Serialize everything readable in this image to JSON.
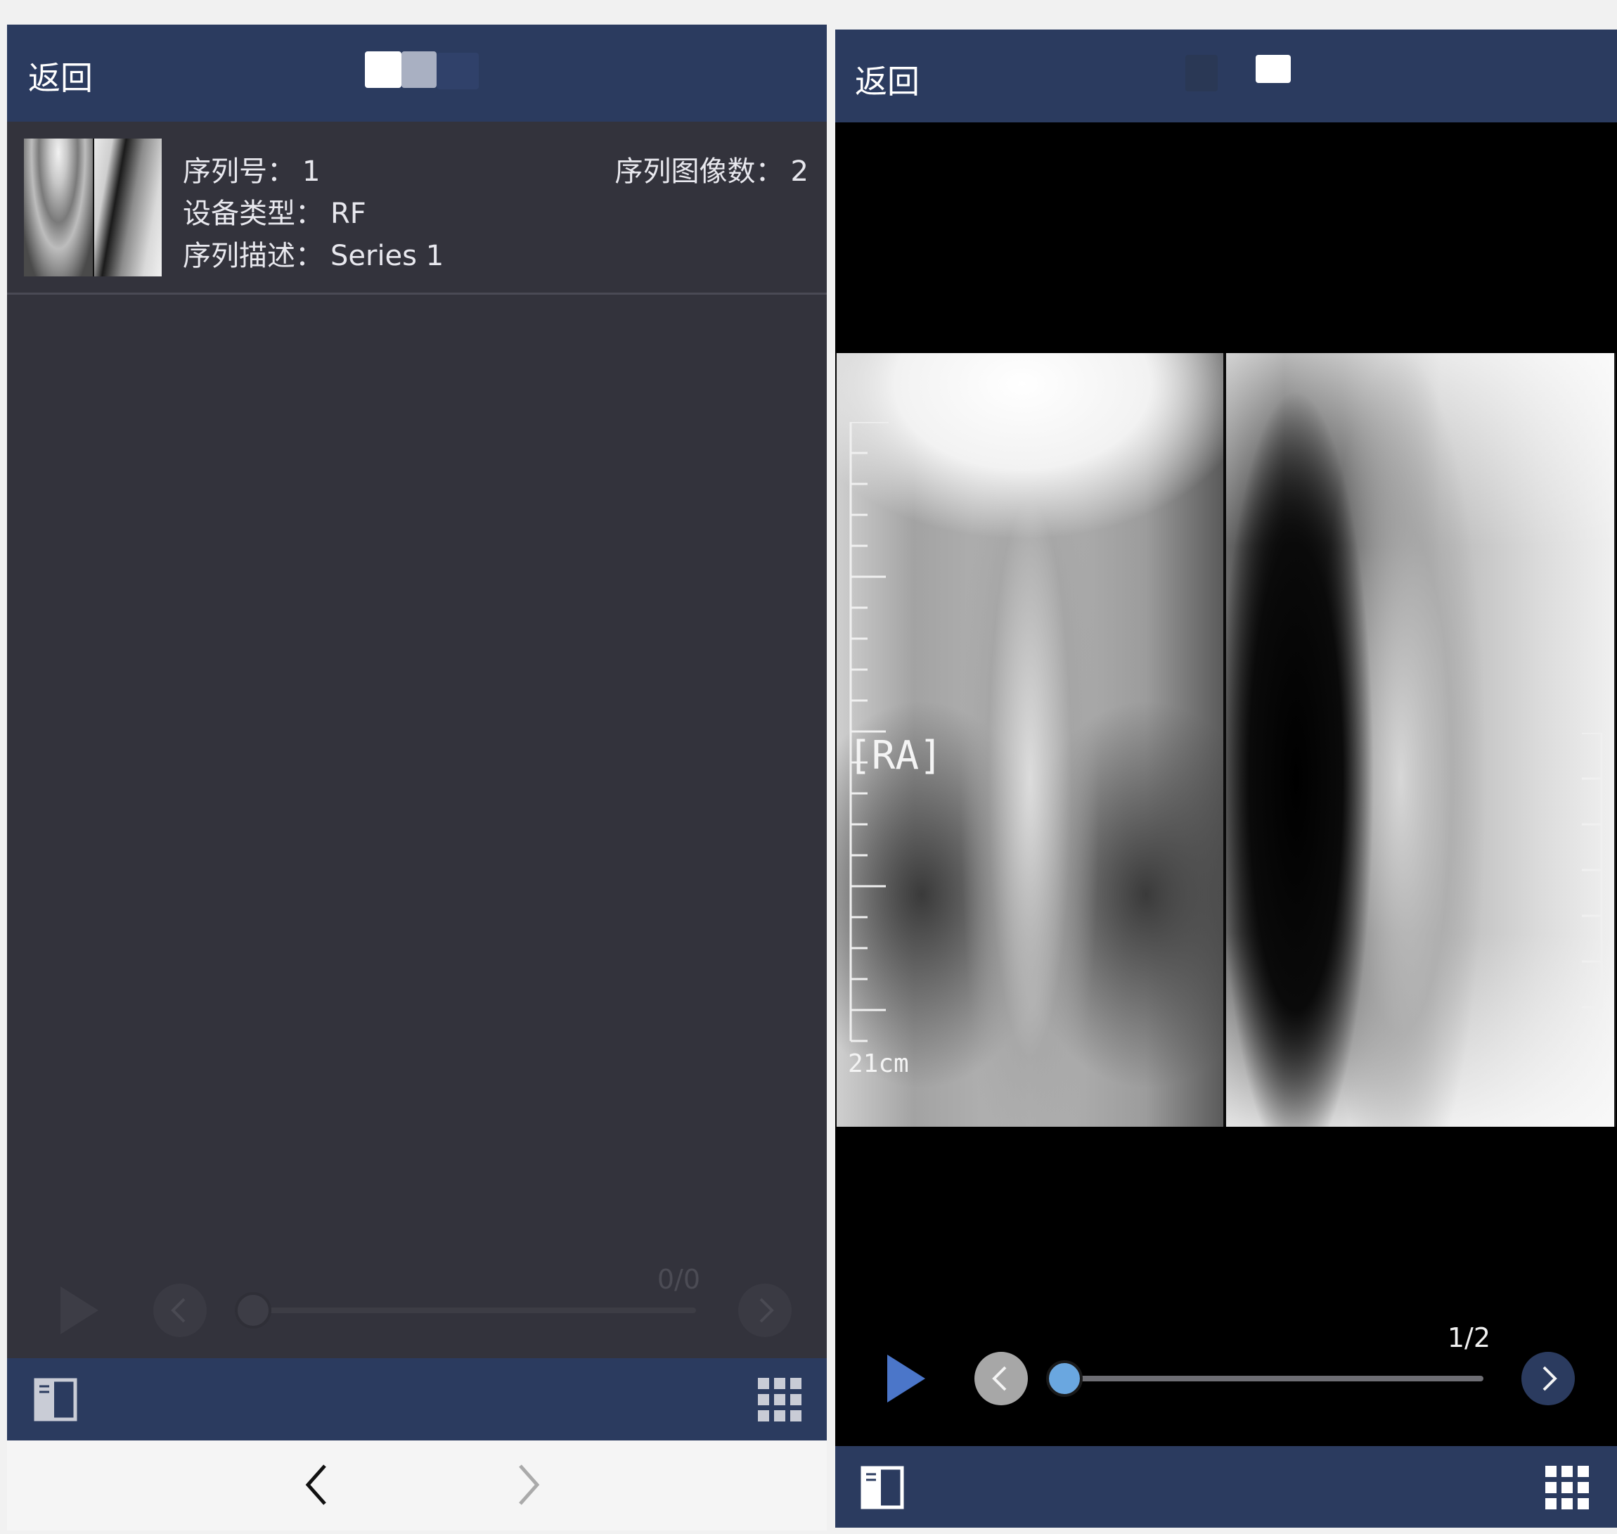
{
  "left_screen": {
    "header": {
      "back_label": "返回"
    },
    "series": {
      "number_label": "序列号：",
      "number_value": "1",
      "image_count_label": "序列图像数：",
      "image_count_value": "2",
      "modality_label": "设备类型：",
      "modality_value": "RF",
      "description_label": "序列描述：",
      "description_value": "Series 1"
    },
    "player": {
      "counter": "0/0",
      "progress": 0
    },
    "icons": {
      "play": "play-icon",
      "prev": "chevron-left-icon",
      "next": "chevron-right-icon",
      "series_list": "series-panel-icon",
      "grid": "grid-icon",
      "browser_back": "browser-back-icon",
      "browser_forward": "browser-forward-icon"
    }
  },
  "right_screen": {
    "header": {
      "back_label": "返回"
    },
    "image_overlay": {
      "orientation_marker": "[RA]",
      "ruler_label": "21cm"
    },
    "player": {
      "counter": "1/2",
      "progress": 0
    },
    "icons": {
      "play": "play-icon",
      "prev": "chevron-left-icon",
      "next": "chevron-right-icon",
      "series_list": "series-panel-icon",
      "grid": "grid-icon"
    }
  },
  "colors": {
    "header_bg": "#2b3b5f",
    "content_bg": "#33333c",
    "accent_blue": "#4b76c9",
    "knob_blue": "#6aa7e0"
  }
}
